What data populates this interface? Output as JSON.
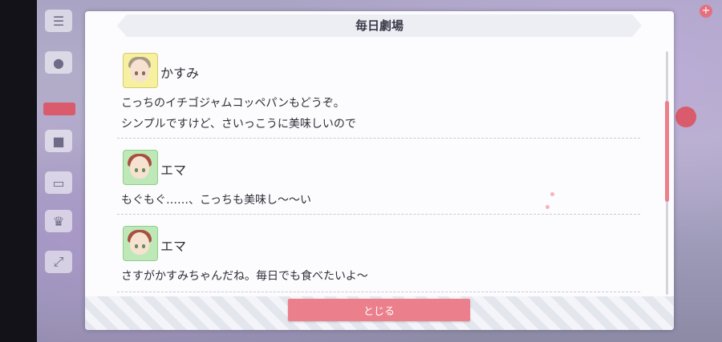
{
  "dialog": {
    "title": "毎日劇場",
    "close_label": "とじる"
  },
  "entries": [
    {
      "speaker": "かすみ",
      "lines": [
        "こっちのイチゴジャムコッペパンもどうぞ。",
        "シンプルですけど、さいっこうに美味しいので"
      ]
    },
    {
      "speaker": "エマ",
      "lines": [
        "もぐもぐ……、こっちも美味し～～い"
      ]
    },
    {
      "speaker": "エマ",
      "lines": [
        "さすがかすみちゃんだね。毎日でも食べたいよ～"
      ]
    }
  ],
  "icons": [
    "menu-icon",
    "chat-icon",
    "gift-icon",
    "monitor-icon",
    "crown-icon",
    "expand-icon",
    "plus-icon"
  ],
  "colors": {
    "accent": "#ec7f8c",
    "kasumi_bg": "#f6f0a0",
    "emma_bg": "#bfe8b8"
  }
}
